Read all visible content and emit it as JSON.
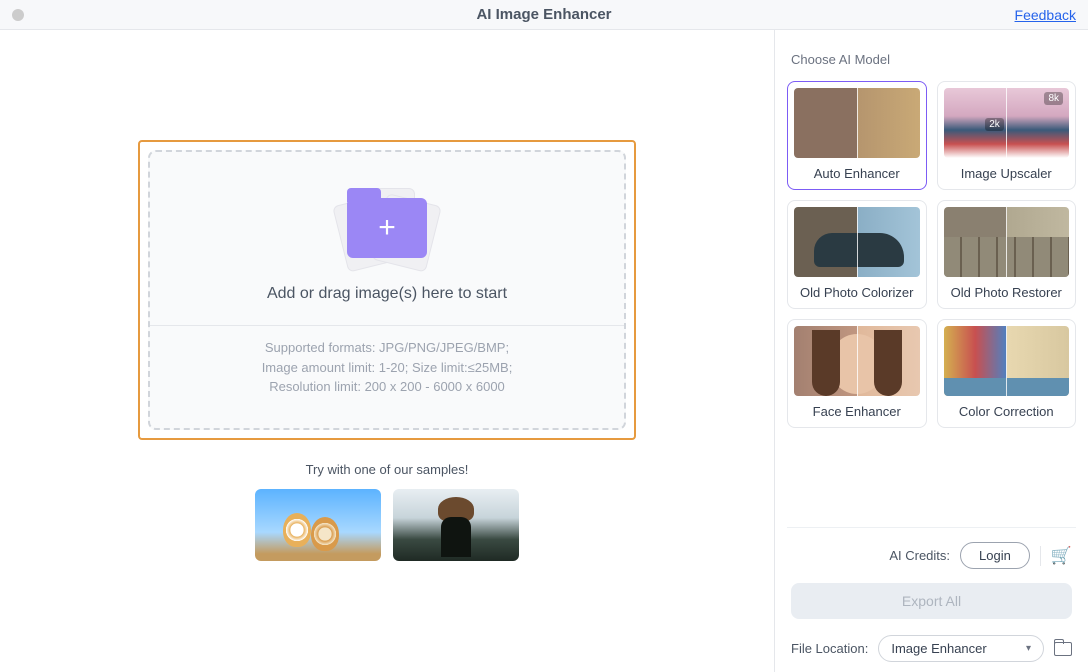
{
  "titlebar": {
    "title": "AI Image Enhancer",
    "feedback": "Feedback"
  },
  "dropzone": {
    "main_text": "Add or drag image(s) here to start",
    "info_line1": "Supported formats: JPG/PNG/JPEG/BMP;",
    "info_line2": "Image amount limit: 1-20; Size limit:≤25MB;",
    "info_line3": "Resolution limit: 200 x 200 - 6000 x 6000"
  },
  "samples_label": "Try with one of our samples!",
  "right": {
    "choose_model": "Choose AI Model",
    "models": {
      "auto_enhancer": "Auto Enhancer",
      "image_upscaler": "Image Upscaler",
      "old_photo_colorizer": "Old Photo Colorizer",
      "old_photo_restorer": "Old Photo Restorer",
      "face_enhancer": "Face Enhancer",
      "color_correction": "Color Correction",
      "badge_2k": "2k",
      "badge_8k": "8k"
    },
    "credits_label": "AI Credits:",
    "login": "Login",
    "export_all": "Export All",
    "file_location_label": "File Location:",
    "file_location_value": "Image Enhancer"
  }
}
